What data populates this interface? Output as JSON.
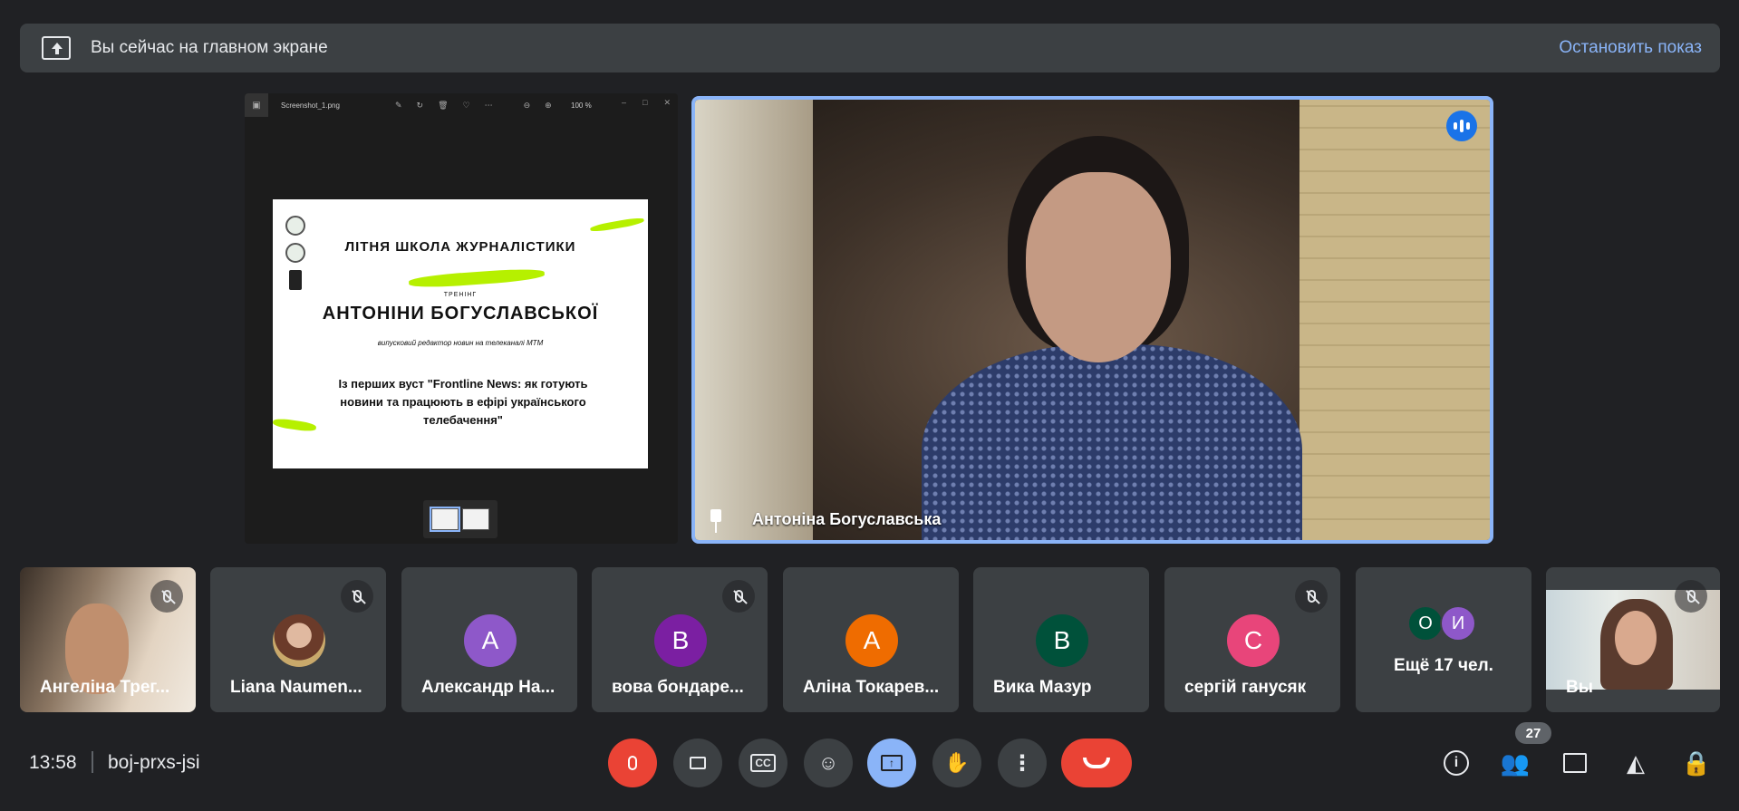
{
  "banner": {
    "text": "Вы сейчас на главном экране",
    "stop_label": "Остановить показ"
  },
  "shared_screen": {
    "viewer": {
      "filename": "Screenshot_1.png",
      "zoom": "100 %"
    },
    "slide": {
      "heading": "ЛІТНЯ ШКОЛА ЖУРНАЛІСТИКИ",
      "label": "ТРЕНІНГ",
      "name": "АНТОНІНИ БОГУСЛАВСЬКОЇ",
      "role": "випусковий редактор новин на телеканалі МТМ",
      "topic": "Із перших вуст \"Frontline News: як готують новини та працюють в ефірі українського телебачення\""
    }
  },
  "main_speaker": {
    "name": "Антоніна Богуславська"
  },
  "participants": [
    {
      "name": "Ангеліна Трег...",
      "type": "video",
      "muted": true
    },
    {
      "name": "Liana Naumen...",
      "type": "photo",
      "muted": true
    },
    {
      "name": "Александр На...",
      "type": "letter",
      "letter": "А",
      "color": "#8e58c9",
      "muted": false
    },
    {
      "name": "вова бондаре...",
      "type": "letter",
      "letter": "В",
      "color": "#7b1fa2",
      "muted": true
    },
    {
      "name": "Аліна Токарев...",
      "type": "letter",
      "letter": "А",
      "color": "#ef6c00",
      "muted": false
    },
    {
      "name": "Вика Мазур",
      "type": "letter",
      "letter": "В",
      "color": "#00513a",
      "muted": false
    },
    {
      "name": "сергій ганусяк",
      "type": "letter",
      "letter": "С",
      "color": "#e8457a",
      "muted": true
    }
  ],
  "more_tile": {
    "letters": [
      "О",
      "И"
    ],
    "colors": [
      "#00513a",
      "#8e58c9"
    ],
    "text": "Ещё 17 чел."
  },
  "self_tile": {
    "name": "Вы",
    "muted": true
  },
  "bottom_bar": {
    "time": "13:58",
    "meeting_code": "boj-prxs-jsi",
    "people_count": "27"
  }
}
